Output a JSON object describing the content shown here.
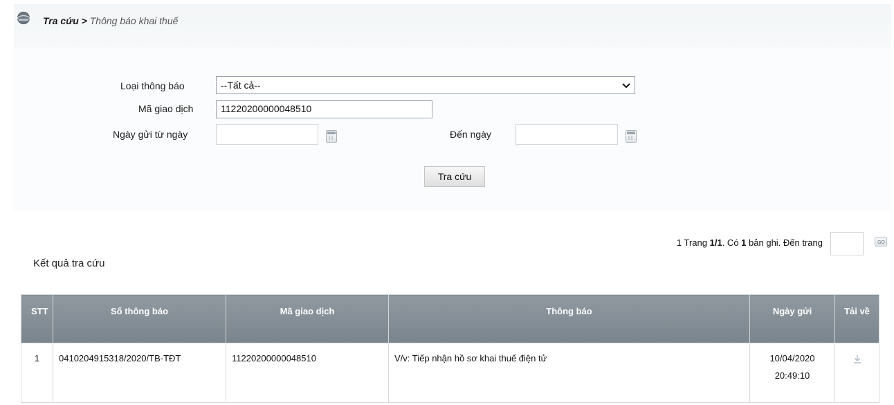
{
  "breadcrumb": {
    "root": "Tra cứu",
    "separator": ">",
    "current": "Thông báo khai thuế"
  },
  "form": {
    "notice_type_label": "Loại thông báo",
    "notice_type_value": "--Tất cả--",
    "transaction_code_label": "Mã giao dịch",
    "transaction_code_value": "11220200000048510",
    "date_from_label": "Ngày gửi từ ngày",
    "date_from_value": "",
    "date_to_label": "Đến ngày",
    "date_to_value": "",
    "search_button": "Tra cứu"
  },
  "pagination": {
    "current_page": "1",
    "page_text": "Trang",
    "page_of": "1/1",
    "record_prefix": ". Có",
    "record_count": "1",
    "record_suffix": "bản ghi. Đến trang",
    "goto_value": ""
  },
  "results": {
    "title": "Kết quả tra cứu",
    "columns": [
      "STT",
      "Số thông báo",
      "Mã giao dịch",
      "Thông báo",
      "Ngày gửi",
      "Tải về"
    ],
    "rows": [
      {
        "stt": "1",
        "notice_number": "0410204915318/2020/TB-TĐT",
        "transaction_code": "11220200000048510",
        "notice": "V/v: Tiếp nhận hồ sơ khai thuế điện tử",
        "date": "10/04/2020",
        "time": "20:49:10"
      }
    ]
  },
  "icons": {
    "breadcrumb": "globe-icon",
    "calendar": "calendar-icon",
    "go": "go-icon",
    "download": "download-icon"
  },
  "colors": {
    "table_header_bg": "#848e96",
    "table_header_text": "#ffffff"
  }
}
